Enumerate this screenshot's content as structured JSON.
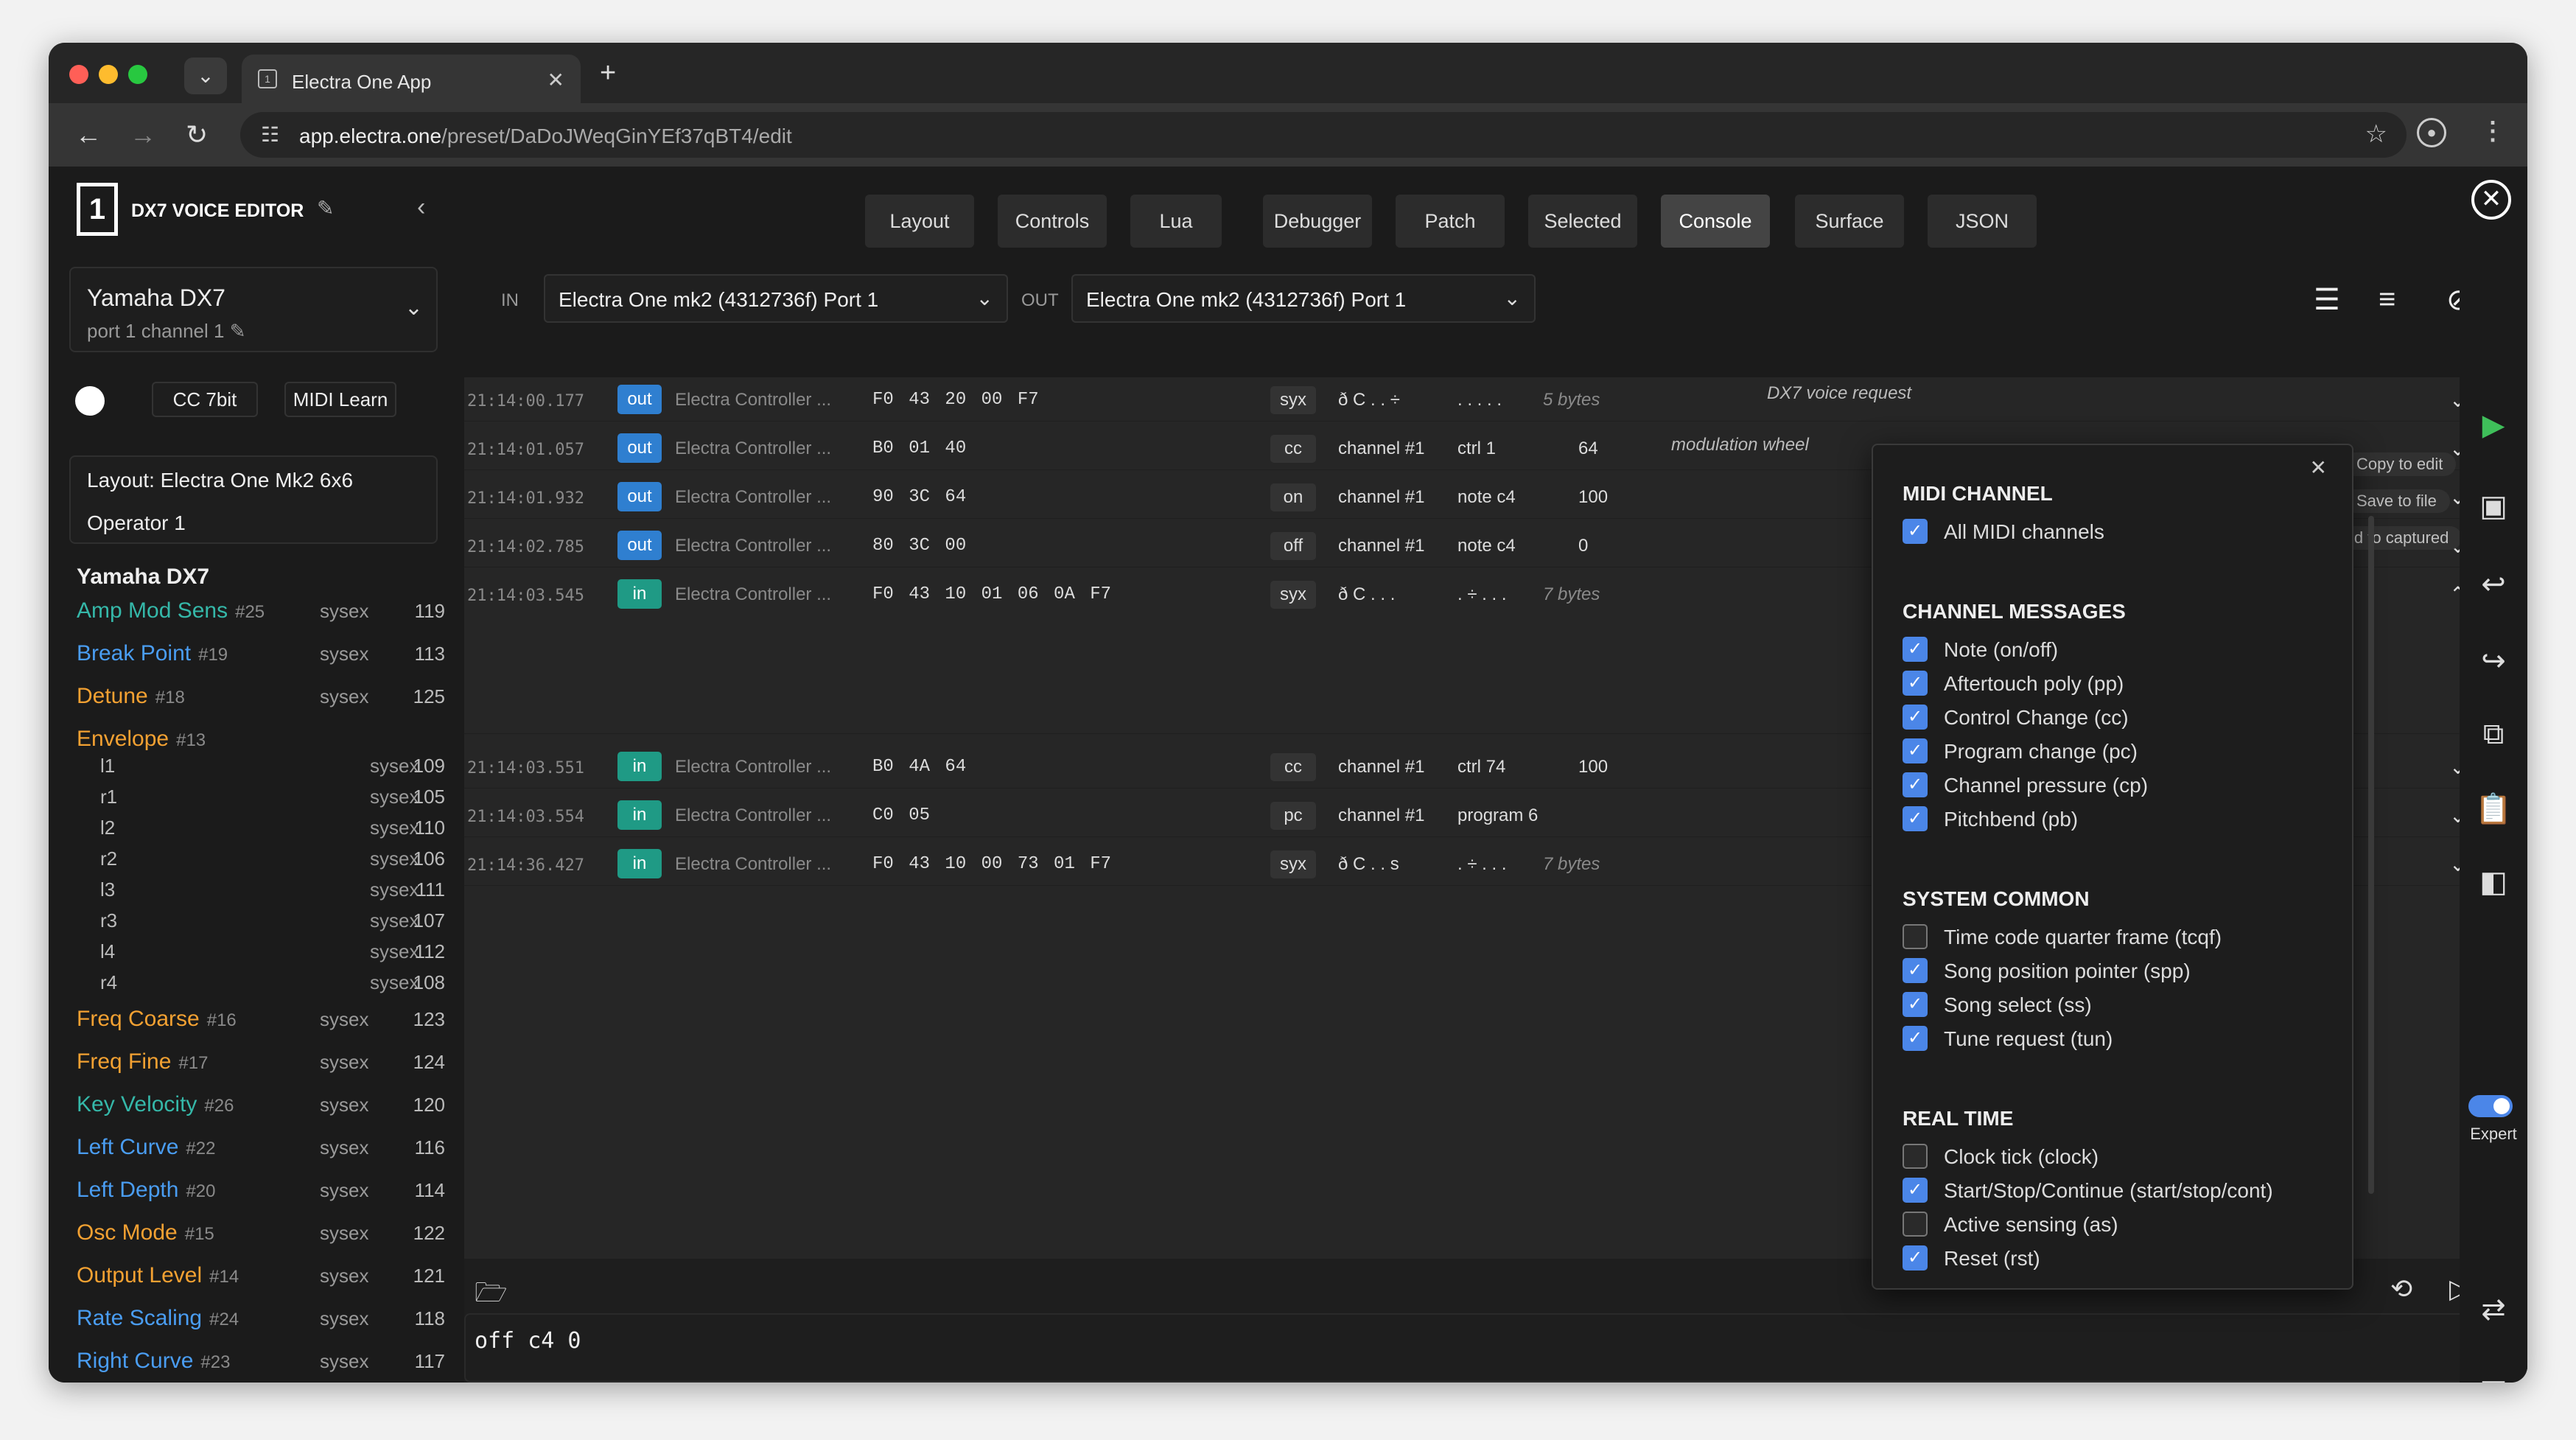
{
  "browser": {
    "tab_title": "Electra One App",
    "url_host": "app.electra.one",
    "url_path": "/preset/DaDoJWeqGinYEf37qBT4/edit"
  },
  "app": {
    "preset_title": "DX7 VOICE EDITOR",
    "close_glyph": "✕"
  },
  "device": {
    "name": "Yamaha DX7",
    "channel": "port 1 channel 1"
  },
  "controls": {
    "cc_mode": "CC 7bit",
    "midi_learn": "MIDI Learn"
  },
  "layout": {
    "label": "Layout: Electra One Mk2 6x6",
    "page": "Operator 1"
  },
  "group": "Yamaha DX7",
  "params": [
    {
      "name": "Amp Mod Sens",
      "id": "#25",
      "type": "sysex",
      "value": "119",
      "color": "#35b8a9"
    },
    {
      "name": "Break Point",
      "id": "#19",
      "type": "sysex",
      "value": "113",
      "color": "#4a9df2"
    },
    {
      "name": "Detune",
      "id": "#18",
      "type": "sysex",
      "value": "125",
      "color": "#f3a132"
    },
    {
      "name": "Envelope",
      "id": "#13",
      "type": "",
      "value": "",
      "color": "#f3a132"
    }
  ],
  "envelope_items": [
    {
      "name": "l1",
      "type": "sysex",
      "value": "109"
    },
    {
      "name": "r1",
      "type": "sysex",
      "value": "105"
    },
    {
      "name": "l2",
      "type": "sysex",
      "value": "110"
    },
    {
      "name": "r2",
      "type": "sysex",
      "value": "106"
    },
    {
      "name": "l3",
      "type": "sysex",
      "value": "111"
    },
    {
      "name": "r3",
      "type": "sysex",
      "value": "107"
    },
    {
      "name": "l4",
      "type": "sysex",
      "value": "112"
    },
    {
      "name": "r4",
      "type": "sysex",
      "value": "108"
    }
  ],
  "params2": [
    {
      "name": "Freq Coarse",
      "id": "#16",
      "type": "sysex",
      "value": "123",
      "color": "#f3a132"
    },
    {
      "name": "Freq Fine",
      "id": "#17",
      "type": "sysex",
      "value": "124",
      "color": "#f3a132"
    },
    {
      "name": "Key Velocity",
      "id": "#26",
      "type": "sysex",
      "value": "120",
      "color": "#35b8a9"
    },
    {
      "name": "Left Curve",
      "id": "#22",
      "type": "sysex",
      "value": "116",
      "color": "#4a9df2"
    },
    {
      "name": "Left Depth",
      "id": "#20",
      "type": "sysex",
      "value": "114",
      "color": "#4a9df2"
    },
    {
      "name": "Osc Mode",
      "id": "#15",
      "type": "sysex",
      "value": "122",
      "color": "#f3a132"
    },
    {
      "name": "Output Level",
      "id": "#14",
      "type": "sysex",
      "value": "121",
      "color": "#f3a132"
    },
    {
      "name": "Rate Scaling",
      "id": "#24",
      "type": "sysex",
      "value": "118",
      "color": "#4a9df2"
    },
    {
      "name": "Right Curve",
      "id": "#23",
      "type": "sysex",
      "value": "117",
      "color": "#4a9df2"
    }
  ],
  "tabs": [
    "Layout",
    "Controls",
    "Lua",
    "Debugger",
    "Patch",
    "Selected",
    "Console",
    "Surface",
    "JSON"
  ],
  "active_tab": "Console",
  "io": {
    "in_label": "IN",
    "in_port": "Electra One mk2 (4312736f) Port 1",
    "out_label": "OUT",
    "out_port": "Electra One mk2 (4312736f) Port 1"
  },
  "log": [
    {
      "ts": "21:14:00.177",
      "dir": "out",
      "src": "Electra Controller ...",
      "hex": "F0 43 20 00 F7",
      "type": "syx",
      "c1": "ð C . . ÷",
      "c2": ". . . . .",
      "c3": "5 bytes",
      "desc": "DX7 voice request"
    },
    {
      "ts": "21:14:01.057",
      "dir": "out",
      "src": "Electra Controller ...",
      "hex": "B0 01 40",
      "type": "cc",
      "c1": "channel #1",
      "c2": "ctrl 1",
      "c3": "64",
      "desc": "modulation wheel"
    },
    {
      "ts": "21:14:01.932",
      "dir": "out",
      "src": "Electra Controller ...",
      "hex": "90 3C 64",
      "type": "on",
      "c1": "channel #1",
      "c2": "note c4",
      "c3": "100",
      "desc": ""
    },
    {
      "ts": "21:14:02.785",
      "dir": "out",
      "src": "Electra Controller ...",
      "hex": "80 3C 00",
      "type": "off",
      "c1": "channel #1",
      "c2": "note c4",
      "c3": "0",
      "desc": ""
    },
    {
      "ts": "21:14:03.545",
      "dir": "in",
      "src": "Electra Controller ...",
      "hex": "F0 43 10 01 06  0A F7",
      "type": "syx",
      "c1": "ð C . . .",
      "c2": ". ÷ . . .",
      "c3": "7 bytes",
      "desc": ""
    },
    {
      "ts": "21:14:03.551",
      "dir": "in",
      "src": "Electra Controller ...",
      "hex": "B0 4A 64",
      "type": "cc",
      "c1": "channel #1",
      "c2": "ctrl 74",
      "c3": "100",
      "desc": ""
    },
    {
      "ts": "21:14:03.554",
      "dir": "in",
      "src": "Electra Controller ...",
      "hex": "C0 05",
      "type": "pc",
      "c1": "channel #1",
      "c2": "program 6",
      "c3": "",
      "desc": ""
    },
    {
      "ts": "21:14:36.427",
      "dir": "in",
      "src": "Electra Controller ...",
      "hex": "F0 43 10 00 73  01 F7",
      "type": "syx",
      "c1": "ð C . . s",
      "c2": ". ÷ . . .",
      "c3": "7 bytes",
      "desc": ""
    }
  ],
  "row_actions": [
    "Copy to edit",
    "Save to file",
    "Add to captured"
  ],
  "command": "off c4 0",
  "filter": {
    "midi_channel": {
      "title": "MIDI CHANNEL",
      "items": [
        {
          "label": "All MIDI channels",
          "checked": true
        }
      ]
    },
    "channel_messages": {
      "title": "CHANNEL MESSAGES",
      "items": [
        {
          "label": "Note (on/off)",
          "checked": true
        },
        {
          "label": "Aftertouch poly (pp)",
          "checked": true
        },
        {
          "label": "Control Change (cc)",
          "checked": true
        },
        {
          "label": "Program change (pc)",
          "checked": true
        },
        {
          "label": "Channel pressure (cp)",
          "checked": true
        },
        {
          "label": "Pitchbend (pb)",
          "checked": true
        }
      ]
    },
    "system_common": {
      "title": "SYSTEM COMMON",
      "items": [
        {
          "label": "Time code quarter frame (tcqf)",
          "checked": false
        },
        {
          "label": "Song position pointer (spp)",
          "checked": true
        },
        {
          "label": "Song select (ss)",
          "checked": true
        },
        {
          "label": "Tune request (tun)",
          "checked": true
        }
      ]
    },
    "real_time": {
      "title": "REAL TIME",
      "items": [
        {
          "label": "Clock tick (clock)",
          "checked": false
        },
        {
          "label": "Start/Stop/Continue (start/stop/cont)",
          "checked": true
        },
        {
          "label": "Active sensing (as)",
          "checked": false
        },
        {
          "label": "Reset (rst)",
          "checked": true
        }
      ]
    }
  },
  "expert_label": "Expert",
  "colors": {
    "out_badge": "#2f7fd0",
    "in_badge": "#1f9a85",
    "accent": "#4b86e8"
  }
}
